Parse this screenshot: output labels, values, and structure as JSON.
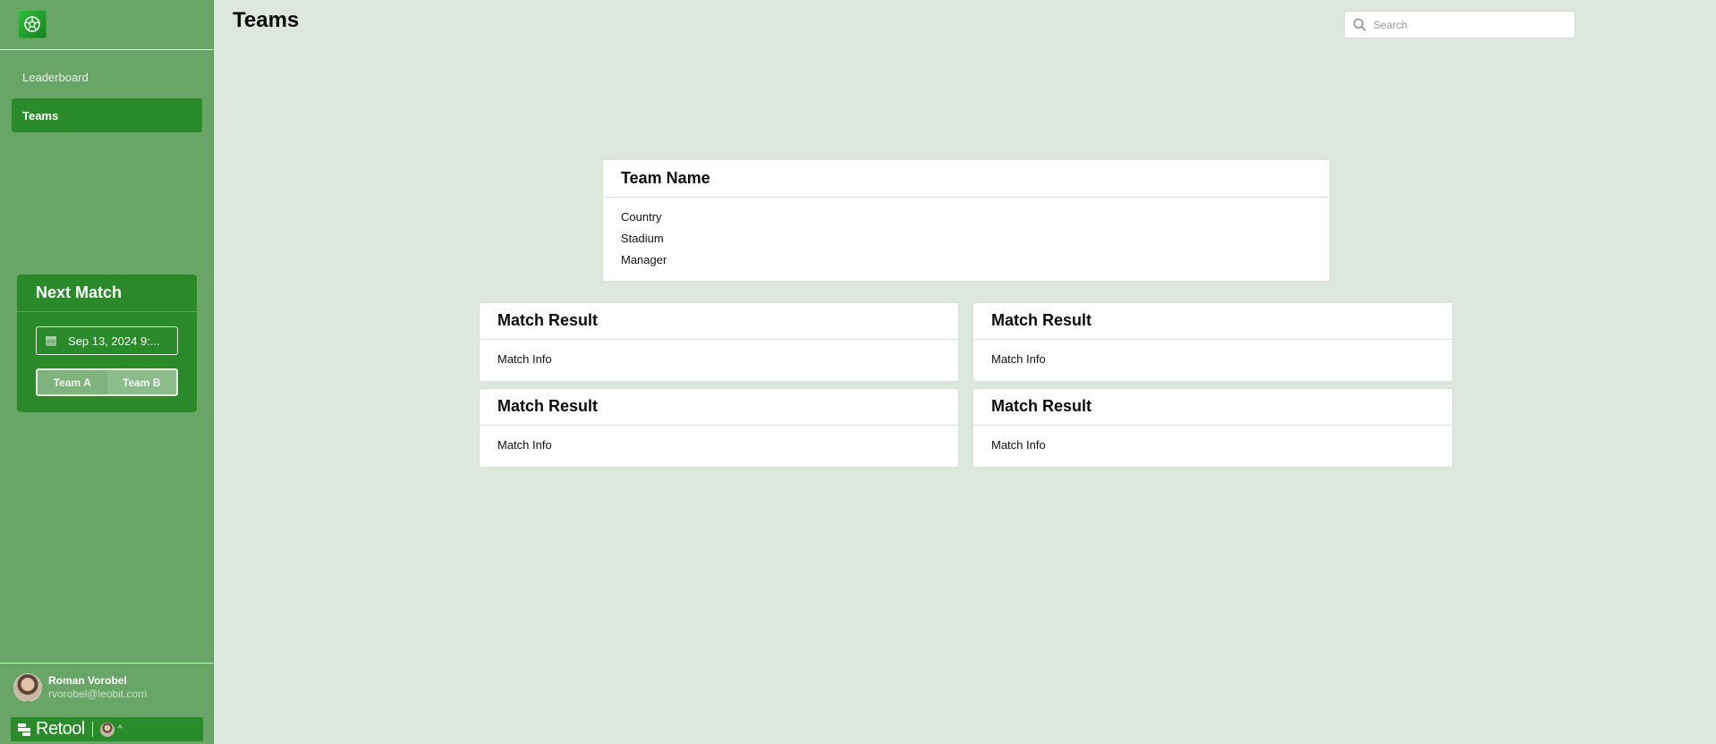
{
  "app": {
    "logo_icon": "soccer-ball-icon"
  },
  "sidebar": {
    "items": [
      {
        "label": "Leaderboard",
        "active": false
      },
      {
        "label": "Teams",
        "active": true
      }
    ],
    "next_match": {
      "title": "Next Match",
      "date_value": "Sep 13, 2024   9:...",
      "date_icon": "calendar-icon",
      "teams": [
        "Team A",
        "Team B"
      ]
    },
    "user": {
      "name": "Roman Vorobel",
      "email": "rvorobel@leobit.com"
    },
    "footer": {
      "brand": "Retool",
      "caret": "^"
    }
  },
  "header": {
    "title": "Teams",
    "search_placeholder": "Search"
  },
  "team_card": {
    "title": "Team Name",
    "fields": [
      "Country",
      "Stadium",
      "Manager"
    ]
  },
  "match_results": [
    {
      "title": "Match Result",
      "info": "Match Info"
    },
    {
      "title": "Match Result",
      "info": "Match Info"
    },
    {
      "title": "Match Result",
      "info": "Match Info"
    },
    {
      "title": "Match Result",
      "info": "Match Info"
    }
  ],
  "colors": {
    "background": "#dde7dd",
    "sidebar": "#68a566",
    "accent": "#2a8b2a"
  }
}
